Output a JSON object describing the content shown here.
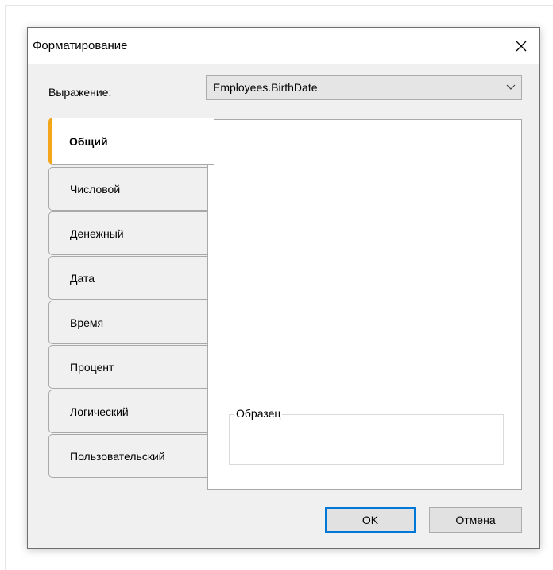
{
  "dialog": {
    "title": "Форматирование",
    "close_icon": "close-icon"
  },
  "expression": {
    "label": "Выражение:",
    "value": "Employees.BirthDate",
    "arrow_icon": "chevron-down-icon"
  },
  "tabs": [
    {
      "label": "Общий",
      "active": true
    },
    {
      "label": "Числовой",
      "active": false
    },
    {
      "label": "Денежный",
      "active": false
    },
    {
      "label": "Дата",
      "active": false
    },
    {
      "label": "Время",
      "active": false
    },
    {
      "label": "Процент",
      "active": false
    },
    {
      "label": "Логический",
      "active": false
    },
    {
      "label": "Пользовательский",
      "active": false
    }
  ],
  "sample": {
    "legend": "Образец",
    "value": ""
  },
  "buttons": {
    "ok_label": "OK",
    "cancel_label": "Отмена"
  },
  "colors": {
    "active_tab_accent": "#f3a619",
    "default_button_border": "#0078d7"
  }
}
